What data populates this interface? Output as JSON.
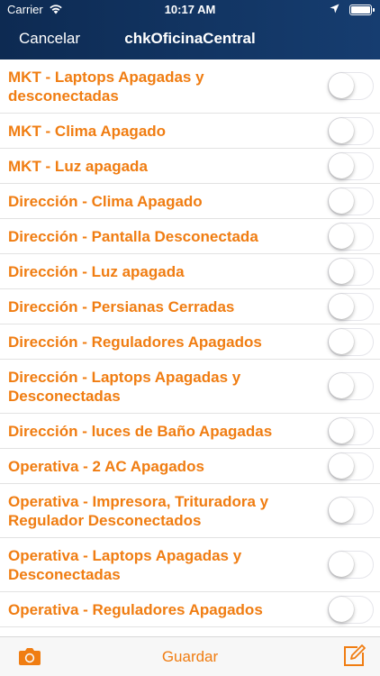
{
  "status_bar": {
    "carrier": "Carrier",
    "time": "10:17 AM"
  },
  "nav": {
    "cancel_label": "Cancelar",
    "title": "chkOficinaCentral"
  },
  "checklist": {
    "items": [
      {
        "label": "MKT - Laptops Apagadas y desconectadas",
        "checked": false
      },
      {
        "label": "MKT - Clima Apagado",
        "checked": false
      },
      {
        "label": "MKT - Luz apagada",
        "checked": false
      },
      {
        "label": "Dirección - Clima Apagado",
        "checked": false
      },
      {
        "label": "Dirección - Pantalla Desconectada",
        "checked": false
      },
      {
        "label": "Dirección - Luz apagada",
        "checked": false
      },
      {
        "label": "Dirección - Persianas Cerradas",
        "checked": false
      },
      {
        "label": "Dirección - Reguladores Apagados",
        "checked": false
      },
      {
        "label": "Dirección - Laptops Apagadas y Desconectadas",
        "checked": false
      },
      {
        "label": "Dirección - luces de Baño Apagadas",
        "checked": false
      },
      {
        "label": "Operativa - 2 AC Apagados",
        "checked": false
      },
      {
        "label": "Operativa - Impresora, Trituradora y Regulador Desconectados",
        "checked": false
      },
      {
        "label": "Operativa - Laptops Apagadas y Desconectadas",
        "checked": false
      },
      {
        "label": "Operativa - Reguladores Apagados",
        "checked": false
      }
    ]
  },
  "toolbar": {
    "save_label": "Guardar",
    "camera_icon": "camera-icon",
    "compose_icon": "compose-icon"
  },
  "colors": {
    "accent": "#f07d12",
    "navbar": "#123563",
    "toggle_off_border": "#e5e5ea"
  }
}
